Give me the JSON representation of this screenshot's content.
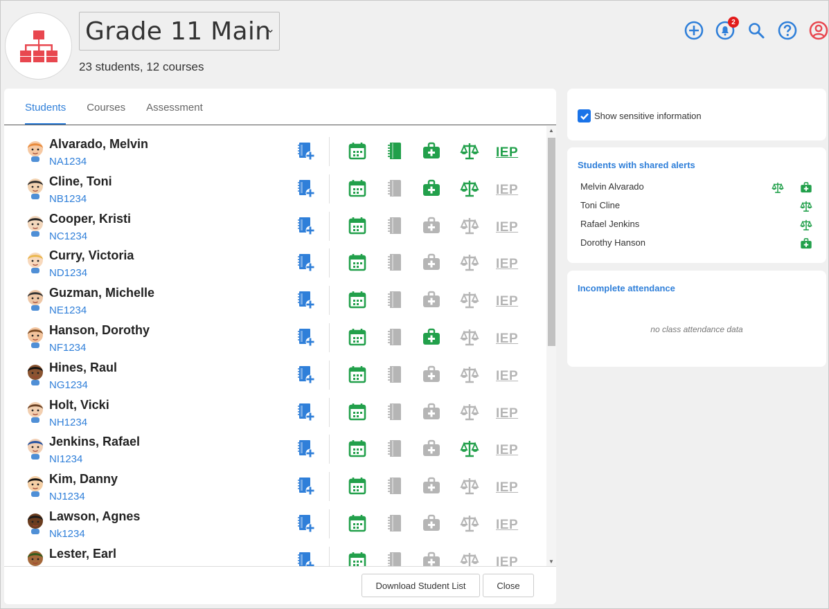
{
  "header": {
    "group_title": "Grade 11 Main",
    "subtitle": "23 students, 12 courses",
    "notification_count": "2"
  },
  "tabs": [
    "Students",
    "Courses",
    "Assessment"
  ],
  "students": [
    {
      "name": "Alvarado, Melvin",
      "id": "NA1234",
      "note": true,
      "medical": true,
      "legal": true,
      "iep": true
    },
    {
      "name": "Cline, Toni",
      "id": "NB1234",
      "note": false,
      "medical": true,
      "legal": true,
      "iep": false
    },
    {
      "name": "Cooper, Kristi",
      "id": "NC1234",
      "note": false,
      "medical": false,
      "legal": false,
      "iep": false
    },
    {
      "name": "Curry, Victoria",
      "id": "ND1234",
      "note": false,
      "medical": false,
      "legal": false,
      "iep": false
    },
    {
      "name": "Guzman, Michelle",
      "id": "NE1234",
      "note": false,
      "medical": false,
      "legal": false,
      "iep": false
    },
    {
      "name": "Hanson, Dorothy",
      "id": "NF1234",
      "note": false,
      "medical": true,
      "legal": false,
      "iep": false
    },
    {
      "name": "Hines, Raul",
      "id": "NG1234",
      "note": false,
      "medical": false,
      "legal": false,
      "iep": false
    },
    {
      "name": "Holt, Vicki",
      "id": "NH1234",
      "note": false,
      "medical": false,
      "legal": false,
      "iep": false
    },
    {
      "name": "Jenkins, Rafael",
      "id": "NI1234",
      "note": false,
      "medical": false,
      "legal": true,
      "iep": false
    },
    {
      "name": "Kim, Danny",
      "id": "NJ1234",
      "note": false,
      "medical": false,
      "legal": false,
      "iep": false
    },
    {
      "name": "Lawson, Agnes",
      "id": "Nk1234",
      "note": false,
      "medical": false,
      "legal": false,
      "iep": false
    },
    {
      "name": "Lester, Earl",
      "id": "",
      "note": false,
      "medical": false,
      "legal": false,
      "iep": false
    }
  ],
  "iep_label": "IEP",
  "buttons": {
    "download": "Download Student List",
    "close": "Close"
  },
  "sidebar": {
    "sensitive_label": "Show sensitive information",
    "shared_alerts_title": "Students with shared alerts",
    "shared_alerts": [
      {
        "name": "Melvin Alvarado",
        "icons": [
          "legal",
          "medical"
        ]
      },
      {
        "name": "Toni Cline",
        "icons": [
          "legal"
        ]
      },
      {
        "name": "Rafael Jenkins",
        "icons": [
          "legal"
        ]
      },
      {
        "name": "Dorothy Hanson",
        "icons": [
          "medical"
        ]
      }
    ],
    "attendance_title": "Incomplete attendance",
    "attendance_empty": "no class attendance data"
  },
  "colors": {
    "blue": "#2f7fd9",
    "green": "#22a04b",
    "gray": "#b5b5b5",
    "logo_red": "#e8474f"
  }
}
